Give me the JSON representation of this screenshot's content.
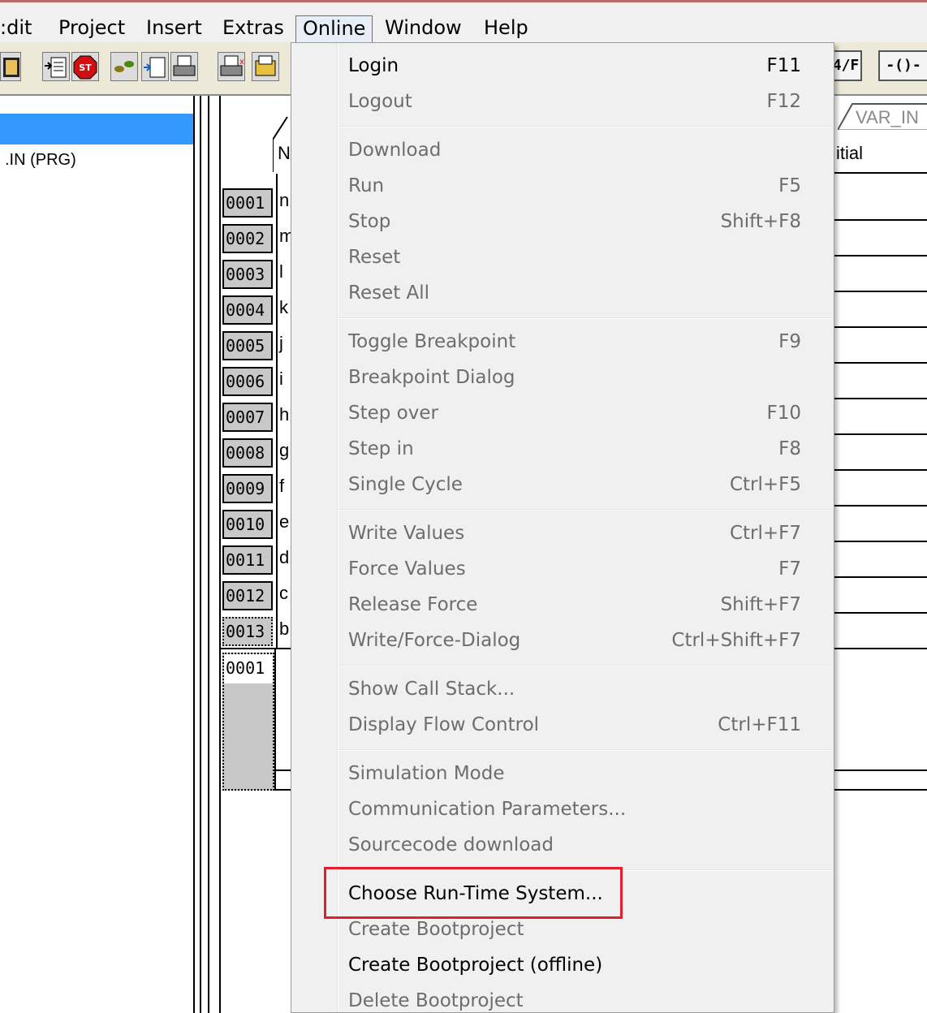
{
  "menubar": {
    "items": [
      "Edit",
      "Project",
      "Insert",
      "Extras",
      "Online",
      "Window",
      "Help"
    ],
    "edit_visible": ":dit",
    "open_menu": "Online"
  },
  "toolbar": {
    "icons": [
      "book-icon",
      "open-icon",
      "stop-icon",
      "step-icon",
      "insert-icon",
      "print-icon",
      "print-preview-icon",
      "folder-icon"
    ],
    "right_buttons": [
      "4/F",
      "-()-"
    ]
  },
  "organizer": {
    "selected_item": "",
    "item": ".IN (PRG)"
  },
  "editor": {
    "tab_label": "VAR_IN",
    "column_name": "N",
    "column_initial": "itial",
    "rows": [
      {
        "num": "0001",
        "name": "n"
      },
      {
        "num": "0002",
        "name": "m"
      },
      {
        "num": "0003",
        "name": "l"
      },
      {
        "num": "0004",
        "name": "k"
      },
      {
        "num": "0005",
        "name": "j"
      },
      {
        "num": "0006",
        "name": "i"
      },
      {
        "num": "0007",
        "name": "h"
      },
      {
        "num": "0008",
        "name": "g"
      },
      {
        "num": "0009",
        "name": "f"
      },
      {
        "num": "0010",
        "name": "e"
      },
      {
        "num": "0011",
        "name": "d"
      },
      {
        "num": "0012",
        "name": "c"
      },
      {
        "num": "0013",
        "name": "b"
      }
    ],
    "body_line_num": "0001"
  },
  "online_menu": {
    "groups": [
      [
        {
          "label": "Login",
          "shortcut": "F11",
          "enabled": true
        },
        {
          "label": "Logout",
          "shortcut": "F12",
          "enabled": false
        }
      ],
      [
        {
          "label": "Download",
          "shortcut": "",
          "enabled": false
        },
        {
          "label": "Run",
          "shortcut": "F5",
          "enabled": false
        },
        {
          "label": "Stop",
          "shortcut": "Shift+F8",
          "enabled": false
        },
        {
          "label": "Reset",
          "shortcut": "",
          "enabled": false
        },
        {
          "label": "Reset All",
          "shortcut": "",
          "enabled": false
        }
      ],
      [
        {
          "label": "Toggle Breakpoint",
          "shortcut": "F9",
          "enabled": false
        },
        {
          "label": "Breakpoint Dialog",
          "shortcut": "",
          "enabled": false
        },
        {
          "label": "Step over",
          "shortcut": "F10",
          "enabled": false
        },
        {
          "label": "Step in",
          "shortcut": "F8",
          "enabled": false
        },
        {
          "label": "Single Cycle",
          "shortcut": "Ctrl+F5",
          "enabled": false
        }
      ],
      [
        {
          "label": "Write Values",
          "shortcut": "Ctrl+F7",
          "enabled": false
        },
        {
          "label": "Force Values",
          "shortcut": "F7",
          "enabled": false
        },
        {
          "label": "Release Force",
          "shortcut": "Shift+F7",
          "enabled": false
        },
        {
          "label": "Write/Force-Dialog",
          "shortcut": "Ctrl+Shift+F7",
          "enabled": false
        }
      ],
      [
        {
          "label": "Show Call Stack...",
          "shortcut": "",
          "enabled": false
        },
        {
          "label": "Display Flow Control",
          "shortcut": "Ctrl+F11",
          "enabled": false
        }
      ],
      [
        {
          "label": "Simulation Mode",
          "shortcut": "",
          "enabled": false
        },
        {
          "label": "Communication Parameters...",
          "shortcut": "",
          "enabled": false
        },
        {
          "label": "Sourcecode download",
          "shortcut": "",
          "enabled": false
        }
      ],
      [
        {
          "label": "Choose Run-Time System...",
          "shortcut": "",
          "enabled": true
        },
        {
          "label": "Create Bootproject",
          "shortcut": "",
          "enabled": false
        },
        {
          "label": "Create Bootproject (offline)",
          "shortcut": "",
          "enabled": true
        },
        {
          "label": "Delete Bootproject",
          "shortcut": "",
          "enabled": false
        }
      ]
    ],
    "highlight_color": "#e0202a"
  }
}
